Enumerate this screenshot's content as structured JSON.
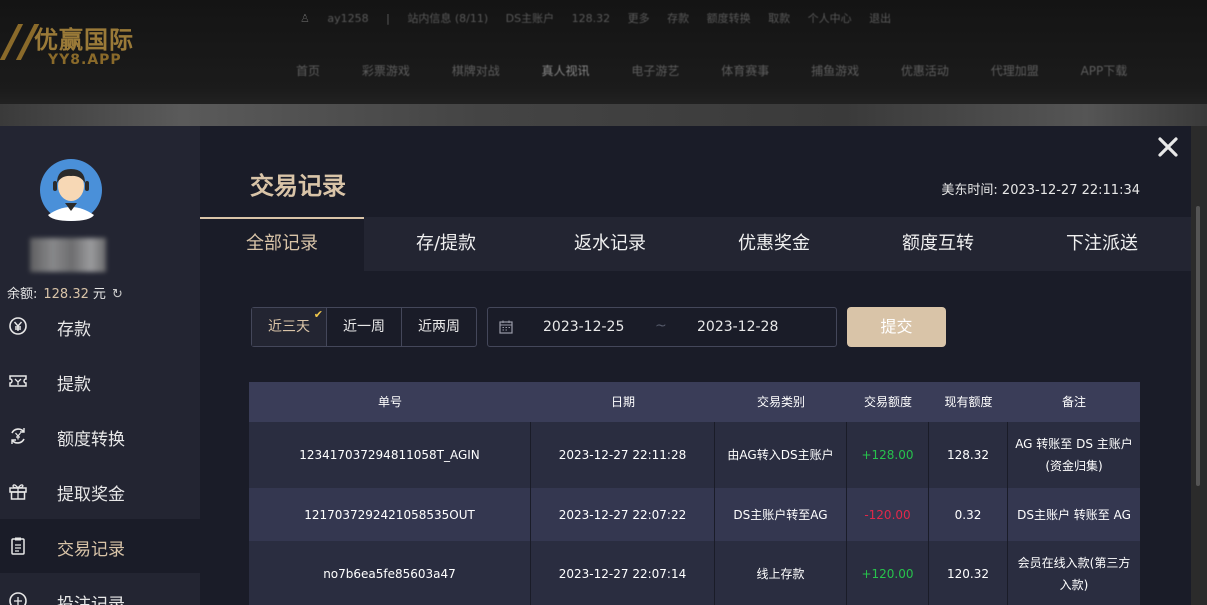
{
  "background": {
    "logo": {
      "cn": "优赢国际",
      "en": "YY8.APP"
    },
    "topbar": [
      "ay1258",
      "站内信息 (8/11)",
      "DS主账户",
      "128.32",
      "更多",
      "存款",
      "额度转换",
      "取款",
      "个人中心",
      "退出",
      "",
      "",
      ""
    ],
    "nav": [
      "首页",
      "彩票游戏",
      "棋牌对战",
      "真人视讯",
      "电子游艺",
      "体育赛事",
      "捕鱼游戏",
      "优惠活动",
      "代理加盟",
      "APP下载"
    ]
  },
  "sidebar": {
    "balance_label": "余额:",
    "balance_value": "128.32",
    "balance_unit": "元",
    "menu": [
      {
        "label": "存款",
        "icon": "yen-coin-icon"
      },
      {
        "label": "提款",
        "icon": "ticket-icon"
      },
      {
        "label": "额度转换",
        "icon": "exchange-icon"
      },
      {
        "label": "提取奖金",
        "icon": "gift-icon"
      },
      {
        "label": "交易记录",
        "icon": "clipboard-icon"
      },
      {
        "label": "投注记录",
        "icon": "bet-icon"
      }
    ],
    "active_index": 4
  },
  "main": {
    "title": "交易记录",
    "clock_label": "美东时间:",
    "clock_value": "2023-12-27 22:11:34",
    "tabs": [
      "全部记录",
      "存/提款",
      "返水记录",
      "优惠奖金",
      "额度互转",
      "下注派送"
    ],
    "active_tab": 0,
    "filter": {
      "ranges": [
        "近三天",
        "近一周",
        "近两周"
      ],
      "selected_range": 0,
      "date_from": "2023-12-25",
      "date_sep": "~",
      "date_to": "2023-12-28",
      "submit_label": "提交"
    },
    "table": {
      "headers": [
        "单号",
        "日期",
        "交易类别",
        "交易额度",
        "现有额度",
        "备注"
      ],
      "rows": [
        {
          "id": "12341703729481105​8T_AGIN",
          "date": "2023-12-27 22:11:28",
          "type": "由AG转入DS主账户",
          "amount": "+128.00",
          "balance": "128.32",
          "note": "AG 转账至 DS 主账户(资金归集)",
          "sign": "pos"
        },
        {
          "id": "121703729242105853​5OUT",
          "date": "2023-12-27 22:07:22",
          "type": "DS主账户转至AG",
          "amount": "-120.00",
          "balance": "0.32",
          "note": "DS主账户 转账至 AG",
          "sign": "neg"
        },
        {
          "id": "no7b6ea5fe85603a47",
          "date": "2023-12-27 22:07:14",
          "type": "线上存款",
          "amount": "+120.00",
          "balance": "120.32",
          "note": "会员在线入款(第三方入款)",
          "sign": "pos"
        }
      ]
    }
  },
  "colors": {
    "accent": "#d9c4a8",
    "positive": "#27c24c",
    "negative": "#e0284a",
    "header_bg": "#3a3d58"
  }
}
